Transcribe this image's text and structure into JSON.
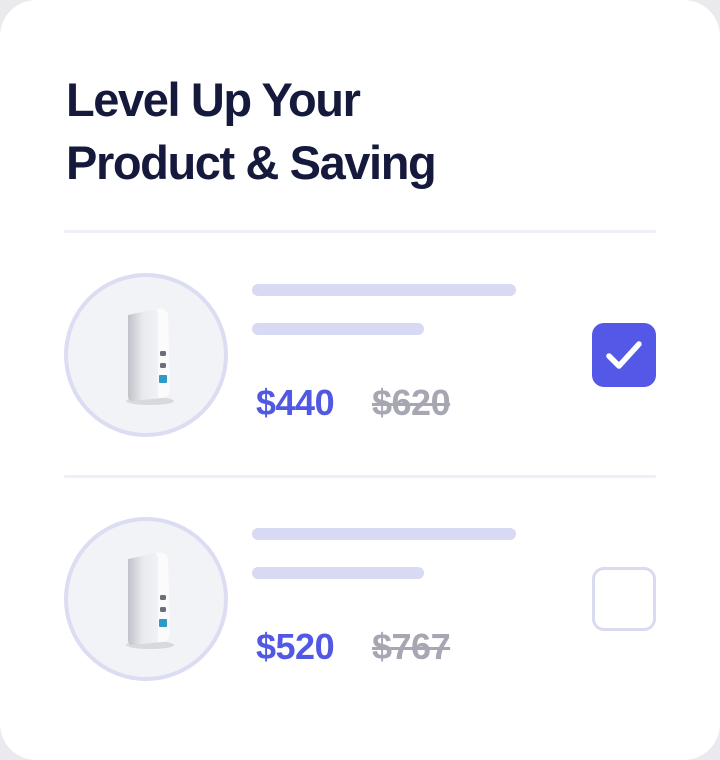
{
  "title": {
    "line1": "Level Up Your",
    "line2": "Product & Saving"
  },
  "colors": {
    "accent": "#5359e6",
    "title": "#151a3d",
    "old_price": "#a6a7b3",
    "skeleton": "#d8d9f3"
  },
  "products": [
    {
      "icon": "charger-image",
      "price": "$440",
      "original_price": "$620",
      "selected": true
    },
    {
      "icon": "charger-image",
      "price": "$520",
      "original_price": "$767",
      "selected": false
    }
  ]
}
